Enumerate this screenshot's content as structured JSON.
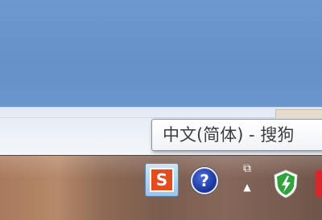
{
  "tooltip": {
    "text": "中文(简体) - 搜狗"
  },
  "tray": {
    "ime_icon_glyph": "S",
    "help_icon_glyph": "?",
    "ime_mode_glyph": "⧉",
    "ime_mode_arrow": "▲"
  },
  "icons": {
    "ime": "sogou-input-icon",
    "help": "help-icon",
    "mode": "input-mode-icon",
    "shield": "security-shield-icon",
    "red": "red-app-icon"
  },
  "colors": {
    "desktop": "#6a93c9",
    "ime_accent": "#e8491d",
    "help_blue": "#1e3aa6",
    "shield_green": "#2fa43a"
  }
}
